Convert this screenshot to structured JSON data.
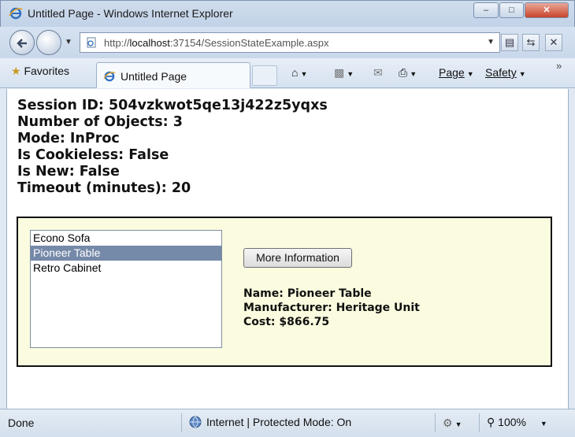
{
  "window": {
    "title": "Untitled Page - Windows Internet Explorer"
  },
  "address_bar": {
    "url_prefix": "http://",
    "url_host": "localhost",
    "url_rest": ":37154/SessionStateExample.aspx"
  },
  "toolbar": {
    "favorites_label": "Favorites",
    "tab_title": "Untitled Page",
    "page_menu": "Page",
    "safety_menu": "Safety"
  },
  "session": {
    "lines": [
      "Session ID: 504vzkwot5qe13j422z5yqxs",
      "Number of Objects: 3",
      "Mode: InProc",
      "Is Cookieless: False",
      "Is New: False",
      "Timeout (minutes): 20"
    ]
  },
  "products": {
    "items": [
      "Econo Sofa",
      "Pioneer Table",
      "Retro Cabinet"
    ],
    "selected": "Pioneer Table",
    "button_label": "More Information",
    "details": [
      "Name: Pioneer Table",
      "Manufacturer: Heritage Unit",
      "Cost: $866.75"
    ]
  },
  "statusbar": {
    "status": "Done",
    "zone": "Internet | Protected Mode: On",
    "zoom": "100%"
  },
  "colors": {
    "panel_bg": "#fbfbdf",
    "selected_bg": "#7589a8"
  }
}
